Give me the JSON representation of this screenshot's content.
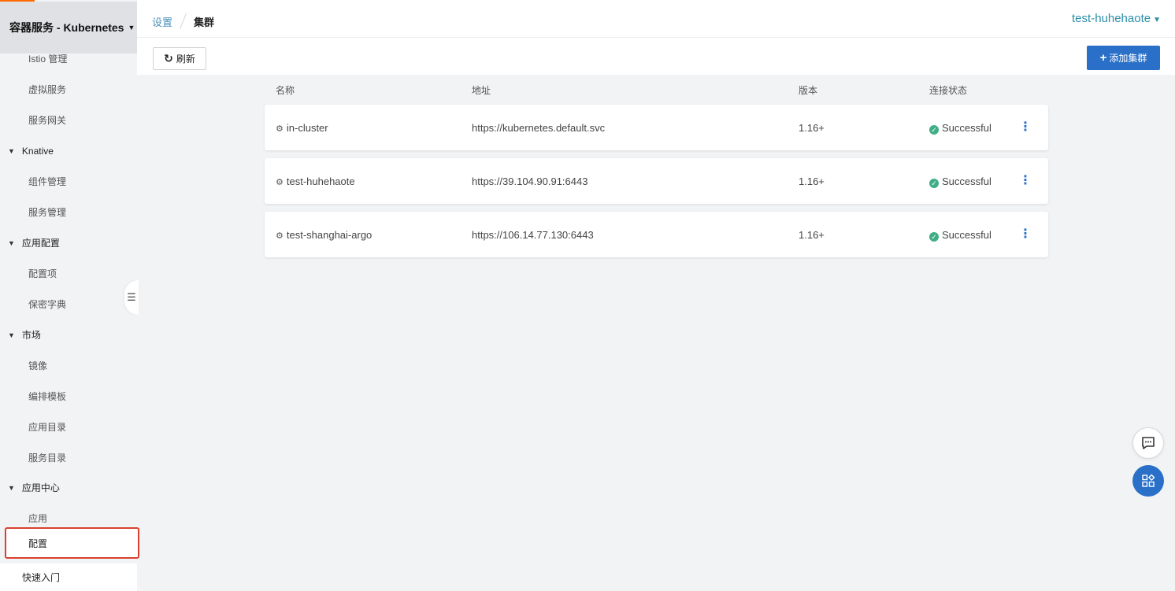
{
  "sidebar": {
    "header_title": "容器服务 - Kubernetes",
    "items": [
      {
        "label": "Istio 管理",
        "kind": "sub"
      },
      {
        "label": "虚拟服务",
        "kind": "sub"
      },
      {
        "label": "服务网关",
        "kind": "sub"
      },
      {
        "label": "Knative",
        "kind": "group"
      },
      {
        "label": "组件管理",
        "kind": "sub"
      },
      {
        "label": "服务管理",
        "kind": "sub"
      },
      {
        "label": "应用配置",
        "kind": "group"
      },
      {
        "label": "配置项",
        "kind": "sub"
      },
      {
        "label": "保密字典",
        "kind": "sub"
      },
      {
        "label": "市场",
        "kind": "group"
      },
      {
        "label": "镜像",
        "kind": "sub"
      },
      {
        "label": "编排模板",
        "kind": "sub"
      },
      {
        "label": "应用目录",
        "kind": "sub"
      },
      {
        "label": "服务目录",
        "kind": "sub"
      },
      {
        "label": "应用中心",
        "kind": "group"
      },
      {
        "label": "应用",
        "kind": "sub"
      },
      {
        "label": "配置",
        "kind": "sub-highlight"
      },
      {
        "label": "快速入门",
        "kind": "root"
      }
    ]
  },
  "breadcrumb": {
    "parent": "设置",
    "current": "集群"
  },
  "user_menu": {
    "label": "test-huhehaote"
  },
  "toolbar": {
    "refresh_label": "刷新",
    "add_label": "添加集群"
  },
  "table": {
    "columns": [
      "名称",
      "地址",
      "版本",
      "连接状态"
    ],
    "rows": [
      {
        "name": "in-cluster",
        "address": "https://kubernetes.default.svc",
        "version": "1.16+",
        "status": "Successful"
      },
      {
        "name": "test-huhehaote",
        "address": "https://39.104.90.91:6443",
        "version": "1.16+",
        "status": "Successful"
      },
      {
        "name": "test-shanghai-argo",
        "address": "https://106.14.77.130:6443",
        "version": "1.16+",
        "status": "Successful"
      }
    ]
  },
  "colors": {
    "accent": "#2a70c8",
    "success": "#3fae86",
    "highlight_border": "#d8412f",
    "brand_orange": "#ff6a00"
  },
  "icons": [
    "caret-down-icon",
    "triangle-down-icon",
    "collapse-sidebar-icon",
    "refresh-icon",
    "plus-icon",
    "cluster-gear-icon",
    "success-check-icon",
    "more-vertical-icon",
    "chat-icon",
    "apps-icon"
  ]
}
